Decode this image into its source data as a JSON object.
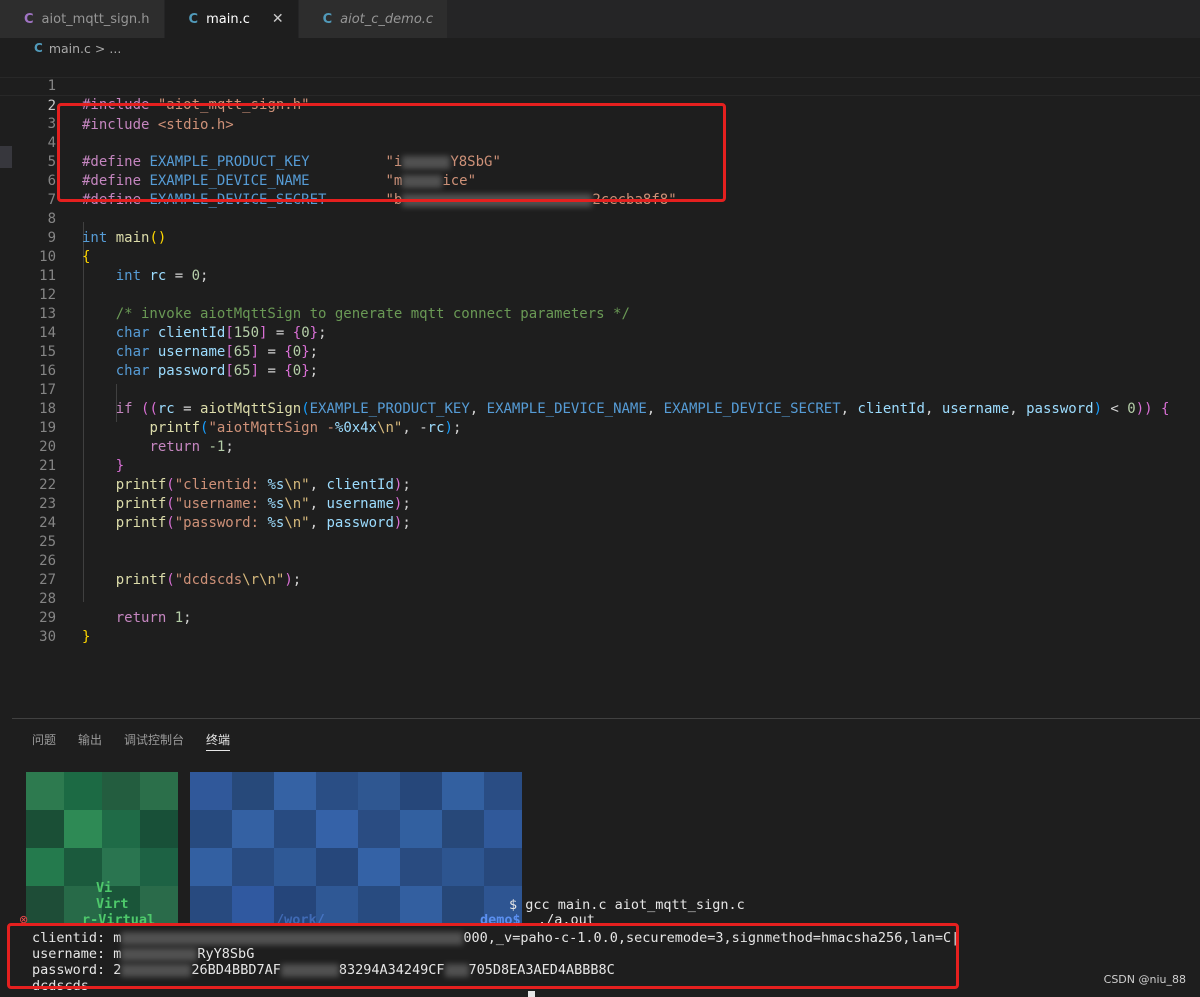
{
  "tabs": [
    {
      "label": "aiot_mqtt_sign.h",
      "icon": "c-file-icon"
    },
    {
      "label": "main.c",
      "icon": "c-file-icon"
    },
    {
      "label": "aiot_c_demo.c",
      "icon": "c-file-icon"
    }
  ],
  "tab_close": "✕",
  "file_letter": "C",
  "breadcrumb": {
    "file": "main.c",
    "sep": ">",
    "rest": "..."
  },
  "code_lines": [
    "#include \"aiot_mqtt_sign.h\"",
    "#include <stdio.h>",
    "",
    "#define EXAMPLE_PRODUCT_KEY         \"i Y8SbG\"",
    "#define EXAMPLE_DEVICE_NAME         \"m ice\"",
    "#define EXAMPLE_DEVICE_SECRET       \"b 2cecba8f8\"",
    "",
    "int main()",
    "{",
    "    int rc = 0;",
    "",
    "    /* invoke aiotMqttSign to generate mqtt connect parameters */",
    "    char clientId[150] = {0};",
    "    char username[65] = {0};",
    "    char password[65] = {0};",
    "",
    "    if ((rc = aiotMqttSign(EXAMPLE_PRODUCT_KEY, EXAMPLE_DEVICE_NAME, EXAMPLE_DEVICE_SECRET, clientId, username, password) < 0)) {",
    "        printf(\"aiotMqttSign -%0x4x\\n\", -rc);",
    "        return -1;",
    "    }",
    "    printf(\"clientid: %s\\n\", clientId);",
    "    printf(\"username: %s\\n\", username);",
    "    printf(\"password: %s\\n\", password);",
    "",
    "",
    "    printf(\"dcdscds\\r\\n\");",
    "",
    "    return 1;",
    "}",
    ""
  ],
  "code_parts": {
    "include": "#include",
    "define": "#define",
    "inc1": "\"aiot_mqtt_sign.h\"",
    "inc2": "<stdio.h>",
    "m1": "EXAMPLE_PRODUCT_KEY",
    "m2": "EXAMPLE_DEVICE_NAME",
    "m3": "EXAMPLE_DEVICE_SECRET",
    "v1a": "\"i",
    "v1b": "Y8SbG\"",
    "v2a": "\"m",
    "v2b": "ice\"",
    "v3a": "\"b",
    "v3b": "2cecba8f8\"",
    "int": "int",
    "char": "char",
    "if": "if",
    "return": "return",
    "main": "main",
    "rc": "rc",
    "zero": "0",
    "one": "1",
    "neg1": "-1",
    "n150": "150",
    "n65": "65",
    "comment": "/* invoke aiotMqttSign to generate mqtt connect parameters */",
    "clientId": "clientId",
    "username": "username",
    "password": "password",
    "sign": "aiotMqttSign",
    "printf": "printf",
    "fmt1": "\"aiotMqttSign -",
    "fmt1b": "%0x4x",
    "fmt1c": "\\n\"",
    "s_client": "\"clientid: ",
    "s_user": "\"username: ",
    "s_pass": "\"password: ",
    "pct_s": "%s",
    "nl": "\\n\"",
    "s_dc": "\"dcdscds",
    "rn": "\\r\\n\"",
    "q": "\""
  },
  "panel_tabs": [
    "问题",
    "输出",
    "调试控制台",
    "终端"
  ],
  "terminal": {
    "gcc_cmd": "$ gcc main.c aiot_mqtt_sign.c",
    "prompt_vi": "Vi",
    "prompt_virt": "Virt",
    "prompt_virtual": "r-Virtual",
    "prompt_path": "/work/",
    "prompt_demo": "demo$",
    "run_cmd": "./a.out",
    "clientid_label": "clientid: ",
    "clientid_pre": "m",
    "clientid_tail": "000,_v=paho-c-1.0.0,securemode=3,signmethod=hmacsha256,lan=C|",
    "username_label": "username: ",
    "username_pre": "m",
    "username_tail": "RyY8SbG",
    "password_label": "password: ",
    "password_pre": "2",
    "password_mid": "26BD4BBD7AF",
    "password_mid2": "83294A34249CF",
    "password_tail": "705D8EA3AED4ABBB8C",
    "last_out": "dcdscds"
  },
  "watermark": "CSDN @niu_88",
  "colors": {
    "editor_bg": "#1e1e1e",
    "highlight_box": "#e5201f",
    "keyword": "#569cd6",
    "string": "#ce9178",
    "preprocessor": "#c586c0"
  }
}
